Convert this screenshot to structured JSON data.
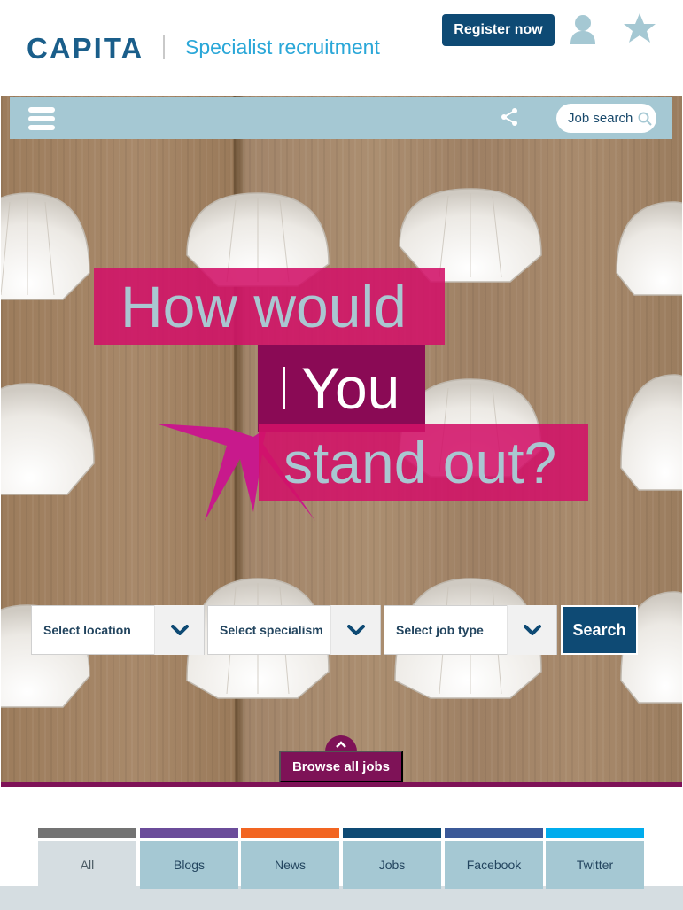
{
  "header": {
    "logo": "CAPITA",
    "tagline": "Specialist recruitment",
    "register_label": "Register now",
    "icons": [
      "user-icon",
      "star-icon"
    ]
  },
  "topbar": {
    "menu_icon": "hamburger-icon",
    "share_icon": "share-icon",
    "job_search_label": "Job search"
  },
  "hero": {
    "line1": "How would",
    "line2": "You",
    "line3": "stand out?"
  },
  "search_form": {
    "location_label": "Select location",
    "specialism_label": "Select specialism",
    "job_type_label": "Select job type",
    "search_label": "Search"
  },
  "browse": {
    "label": "Browse all jobs"
  },
  "tabs": [
    {
      "label": "All",
      "color": "#737373"
    },
    {
      "label": "Blogs",
      "color": "#6b4c9a"
    },
    {
      "label": "News",
      "color": "#f26522"
    },
    {
      "label": "Jobs",
      "color": "#0e4a74"
    },
    {
      "label": "Facebook",
      "color": "#3b5998"
    },
    {
      "label": "Twitter",
      "color": "#00aced"
    }
  ],
  "colors": {
    "brand_navy": "#0e4a74",
    "brand_cyan": "#2aa7d8",
    "magenta": "#d11168",
    "plum": "#7e1257"
  }
}
